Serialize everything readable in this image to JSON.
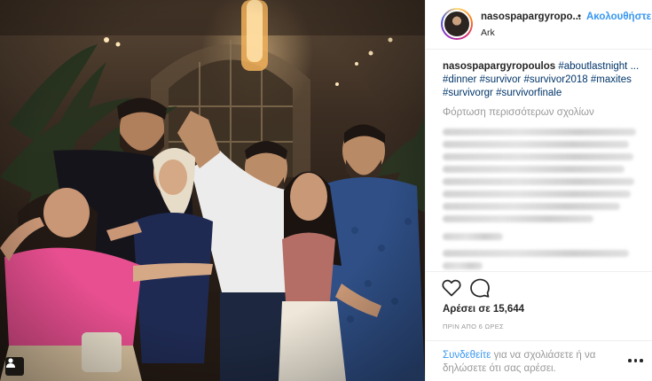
{
  "post": {
    "username": "nasospapargyropo...",
    "separator": "•",
    "follow_label": "Ακολουθήστε",
    "location": "Ark",
    "caption": {
      "username": "nasospapargyropoulos",
      "hashtags": [
        "#aboutlastnight ...",
        "#dinner",
        "#survivor",
        "#survivor2018",
        "#maxites",
        "#survivorgr",
        "#survivorfinale"
      ]
    },
    "load_more_comments": "Φόρτωση περισσότερων σχολίων",
    "likes": "Αρέσει σε 15,644",
    "timestamp": "ΠΡΙΝ ΑΠΟ 6 ΩΡΕΣ",
    "login_prompt": {
      "link": "Συνδεθείτε",
      "text": " για να σχολιάσετε ή να δηλώσετε ότι σας αρέσει."
    },
    "icons": {
      "like": "heart-icon",
      "comment": "comment-bubble-icon",
      "more": "more-options-icon",
      "user_tag": "user-tag-icon"
    }
  },
  "colors": {
    "accent_blue": "#3897f0",
    "hashtag": "#003569",
    "muted": "#999999",
    "text": "#262626"
  }
}
